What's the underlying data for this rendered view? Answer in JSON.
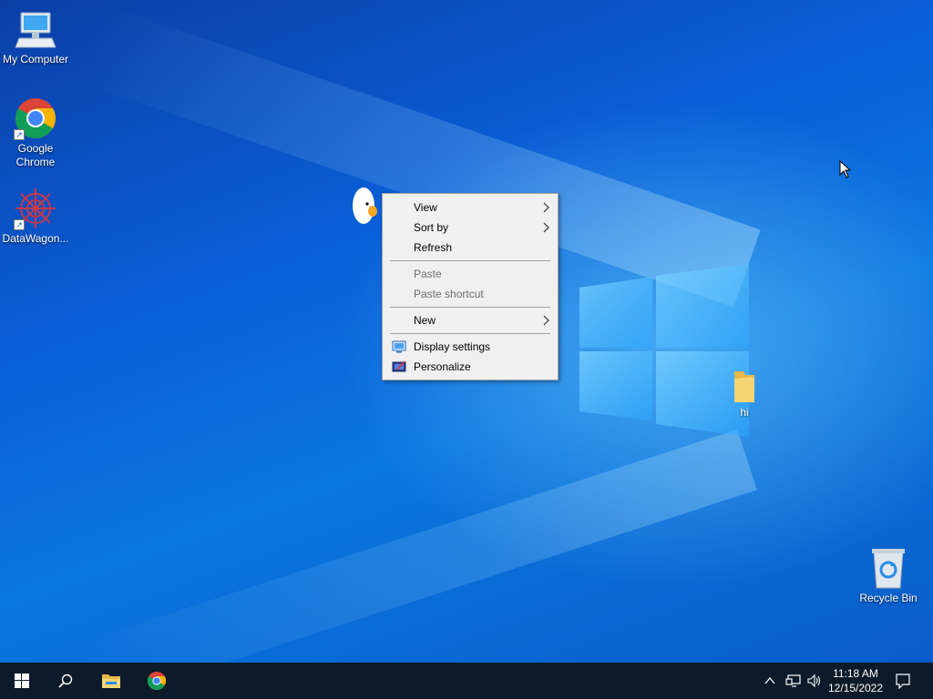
{
  "desktop": {
    "icons": [
      {
        "label": "My Computer"
      },
      {
        "label": "Google\nChrome"
      },
      {
        "label": "DataWagon..."
      },
      {
        "label": "hi"
      },
      {
        "label": "Recycle Bin"
      }
    ]
  },
  "context_menu": {
    "items": [
      {
        "label": "View",
        "submenu": true,
        "enabled": true
      },
      {
        "label": "Sort by",
        "submenu": true,
        "enabled": true
      },
      {
        "label": "Refresh",
        "enabled": true
      },
      {
        "label": "Paste",
        "enabled": false
      },
      {
        "label": "Paste shortcut",
        "enabled": false
      },
      {
        "label": "New",
        "submenu": true,
        "enabled": true
      },
      {
        "label": "Display settings",
        "enabled": true,
        "icon": "display-icon"
      },
      {
        "label": "Personalize",
        "enabled": true,
        "icon": "personalize-icon"
      }
    ]
  },
  "taskbar": {
    "buttons": [
      "start-icon",
      "search-icon",
      "file-explorer-icon",
      "chrome-icon"
    ],
    "tray_icons": [
      "chevron-up-icon",
      "network-icon",
      "volume-icon"
    ],
    "time": "11:18 AM",
    "date": "12/15/2022",
    "notification_icon": "action-center-icon"
  },
  "colors": {
    "taskbar_bg": "#0c1a2a",
    "menu_bg": "#f0f0f0",
    "desktop_blue": "#0a5ed6"
  }
}
